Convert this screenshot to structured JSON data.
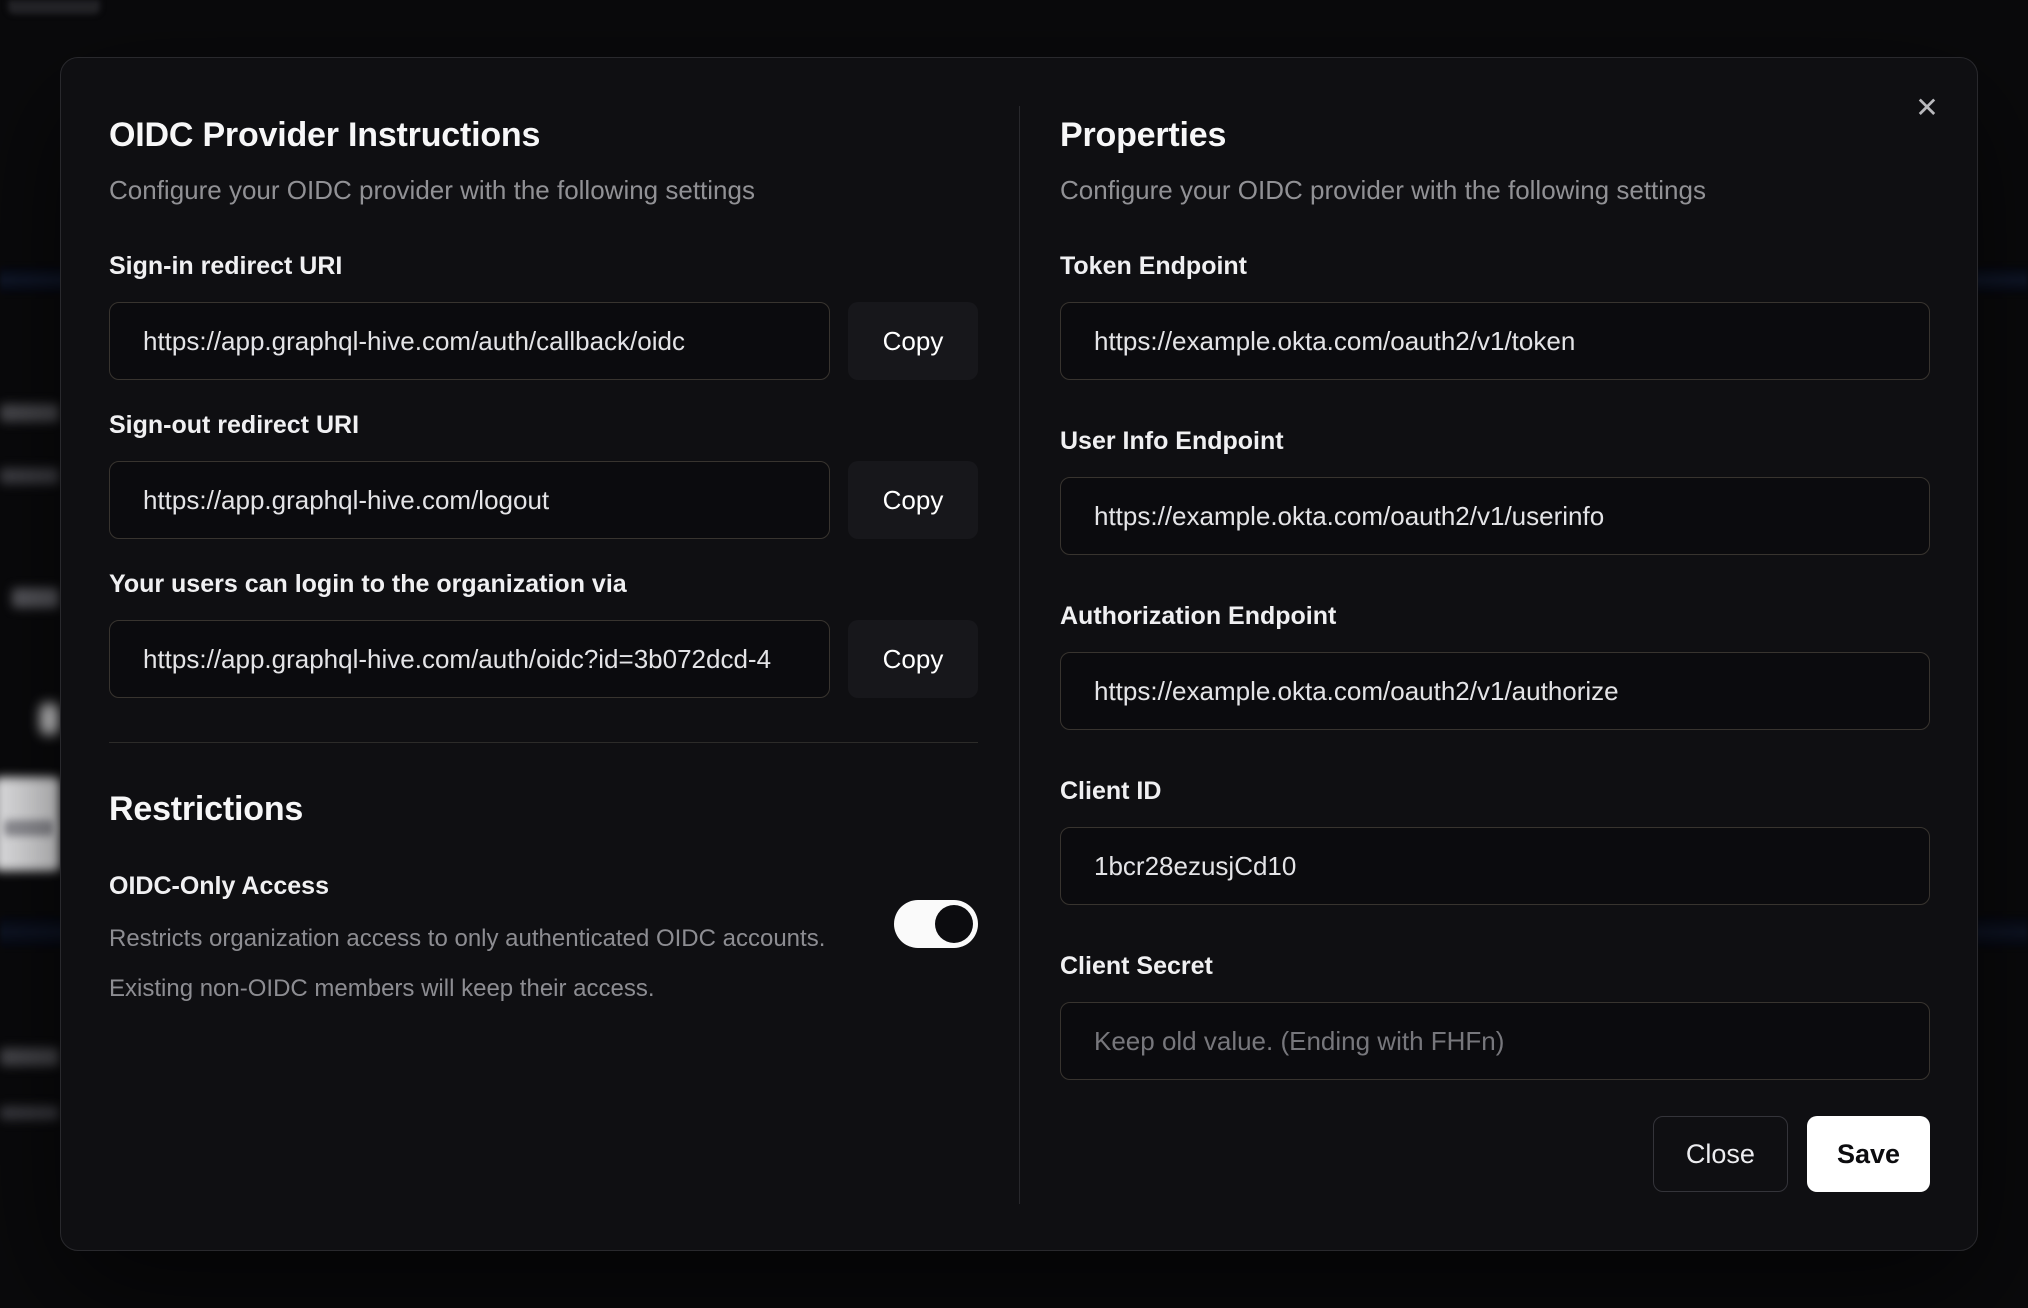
{
  "modal": {
    "close_icon": "✕",
    "left": {
      "title": "OIDC Provider Instructions",
      "subtitle": "Configure your OIDC provider with the following settings",
      "fields": [
        {
          "label": "Sign-in redirect URI",
          "value": "https://app.graphql-hive.com/auth/callback/oidc",
          "copy_label": "Copy"
        },
        {
          "label": "Sign-out redirect URI",
          "value": "https://app.graphql-hive.com/logout",
          "copy_label": "Copy"
        },
        {
          "label": "Your users can login to the organization via",
          "value": "https://app.graphql-hive.com/auth/oidc?id=3b072dcd-4",
          "copy_label": "Copy"
        }
      ],
      "restrictions": {
        "title": "Restrictions",
        "toggle_label": "OIDC-Only Access",
        "description_line1": "Restricts organization access to only authenticated OIDC accounts.",
        "description_line2": "Existing non-OIDC members will keep their access.",
        "toggle_on": true
      }
    },
    "right": {
      "title": "Properties",
      "subtitle": "Configure your OIDC provider with the following settings",
      "fields": [
        {
          "label": "Token Endpoint",
          "value": "https://example.okta.com/oauth2/v1/token"
        },
        {
          "label": "User Info Endpoint",
          "value": "https://example.okta.com/oauth2/v1/userinfo"
        },
        {
          "label": "Authorization Endpoint",
          "value": "https://example.okta.com/oauth2/v1/authorize"
        },
        {
          "label": "Client ID",
          "value": "1bcr28ezusjCd10"
        },
        {
          "label": "Client Secret",
          "value": "",
          "placeholder": "Keep old value. (Ending with FHFn)"
        }
      ],
      "buttons": {
        "close": "Close",
        "save": "Save"
      }
    }
  },
  "colors": {
    "page_bg": "#0a0a0c",
    "modal_bg": "#0f0f12",
    "input_bg": "#0b0b0e",
    "input_border": "#38342f",
    "copy_button_bg": "#17171b",
    "toggle_on_bg": "#fafafa",
    "save_button_bg": "#ffffff",
    "heading_text": "#f7f7f8",
    "muted_text": "#8d8d92"
  }
}
